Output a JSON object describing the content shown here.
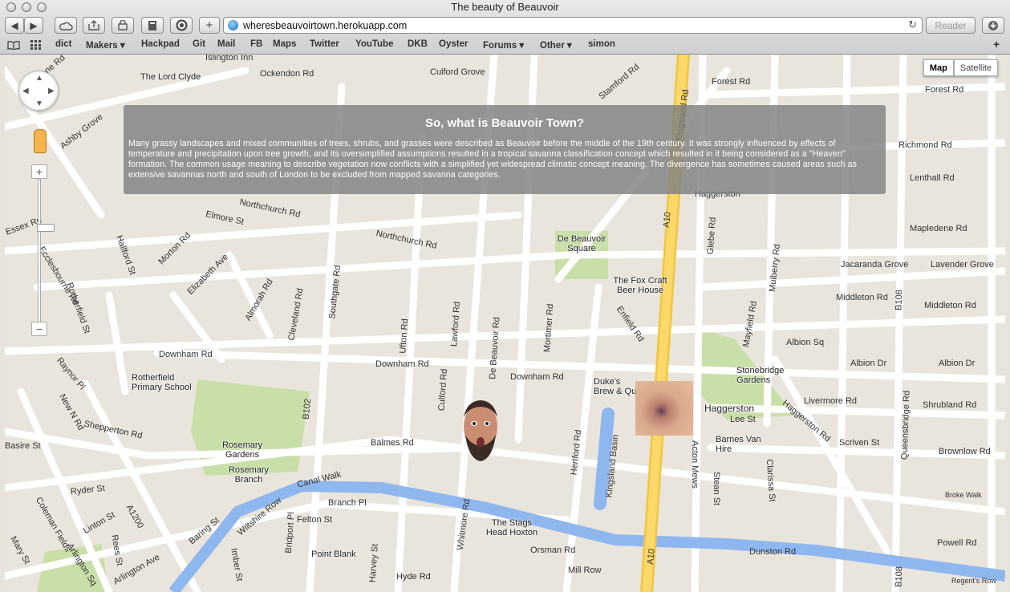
{
  "window": {
    "title": "The beauty of Beauvoir"
  },
  "toolbar": {
    "back": "◀",
    "forward": "▶",
    "url": "wheresbeauvoirtown.herokuapp.com",
    "reload": "↻",
    "reader": "Reader",
    "add": "+"
  },
  "bookmarks": {
    "items": [
      "dict",
      "Makers ▾",
      "Hackpad",
      "Git",
      "Mail",
      "FB",
      "Maps",
      "Twitter",
      "YouTube",
      "DKB",
      "Oyster",
      "Forums ▾",
      "Other ▾",
      "simon"
    ],
    "add": "+"
  },
  "map": {
    "type_buttons": [
      "Map",
      "Satellite"
    ],
    "selected_type": "Map",
    "zoom_in": "+",
    "zoom_out": "−",
    "overlay": {
      "title": "So, what is Beauvoir Town?",
      "body": "Many grassy landscapes and mixed communities of trees, shrubs, and grasses were described as Beauvoir before the middle of the 19th century. It was strongly influenced by effects of temperature and precipitation upon tree growth, and its oversimplified assumptions resulted in a tropical savanna classification concept which resulted in it being considered as a \"Heaven\" formation. The common usage meaning to describe vegetation now conflicts with a simplified yet widespread climatic concept meaning. The divergence has sometimes caused areas such as extensive savannas north and south of London to be excluded from mapped savanna categories."
    },
    "street_labels": [
      "Ockendon Rd",
      "Culford Grove",
      "Stamford Rd",
      "Kingsland Rd",
      "Forest Rd",
      "Forest Rd",
      "Richmond Rd",
      "Lenthall Rd",
      "Mapledene Rd",
      "Jacaranda Grove",
      "Lavender Grove",
      "Middleton Rd",
      "Middleton Rd",
      "Albion Sq",
      "Albion Dr",
      "Albion Dr",
      "Livermore Rd",
      "Shrubland Rd",
      "Lee St",
      "Scriven St",
      "Brownlow Rd",
      "Broke Walk",
      "Powell Rd",
      "Dunston Rd",
      "Regent's Row",
      "Orsman Rd",
      "Mill Row",
      "Hyde Rd",
      "Balmes Rd",
      "Downham Rd",
      "Downham Rd",
      "Downham Rd",
      "Northchurch Rd",
      "Northchurch Rd",
      "Elmore St",
      "Shepperton Rd",
      "Basire St",
      "Canal Walk",
      "Branch Pl",
      "Baring St",
      "Arlington Ave",
      "Arlington Sq",
      "Ecclesbourne Rd",
      "Rotherfield St",
      "Hallford St",
      "Morton Rd",
      "Elizabeth Ave",
      "Almorah Rd",
      "Cleveland Rd",
      "Southgate Rd",
      "De Beauvoir Rd",
      "Culford Rd",
      "Queensbridge Rd",
      "Hertford Rd",
      "Enfield Rd",
      "Mortimer Rd",
      "Lawford Rd",
      "Ufton Rd",
      "Kingsland Basin",
      "Acton Mews",
      "Stean St",
      "Haggerston Rd",
      "Clarissa St",
      "Mayfield Rd",
      "Mulberry Rd",
      "Glebe Rd",
      "B102",
      "A10",
      "A10",
      "B108",
      "B108",
      "A1200",
      "New N Rd",
      "Ashby Grove",
      "Essex Rd",
      "Raynor Pl",
      "Colvestone Rd",
      "Felton St",
      "Bridport Pl",
      "Wiltshire Row",
      "Whitmore Rd",
      "Linton St",
      "Rees St",
      "Coleman Fields",
      "Mary St",
      "Ryder St",
      "Imber St",
      "Harvey St",
      "Islington Inn"
    ],
    "pois": [
      "The Lord Clyde",
      "De Beauvoir Square",
      "The Fox Craft Beer House",
      "Duke's Brew & Que",
      "Haggerston",
      "Stonebridge Gardens",
      "Barnes Van Hire",
      "Rotherfield Primary School",
      "Rosemary Gardens",
      "Rosemary Branch",
      "The Stags Head Hoxton",
      "Point Blank",
      "Haggerston"
    ]
  }
}
